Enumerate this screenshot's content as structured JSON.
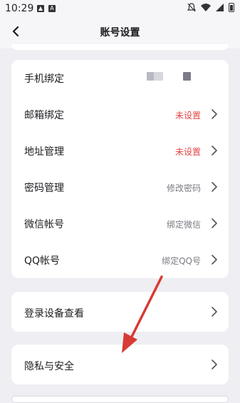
{
  "status_bar": {
    "time": "10:29"
  },
  "header": {
    "title": "账号设置"
  },
  "account_card": {
    "rows": [
      {
        "label": "手机绑定",
        "value": ""
      },
      {
        "label": "邮箱绑定",
        "value": "未设置"
      },
      {
        "label": "地址管理",
        "value": "未设置"
      },
      {
        "label": "密码管理",
        "value": "修改密码"
      },
      {
        "label": "微信帐号",
        "value": "绑定微信"
      },
      {
        "label": "QQ帐号",
        "value": "绑定QQ号"
      }
    ]
  },
  "devices_card": {
    "label": "登录设备查看"
  },
  "privacy_card": {
    "label": "隐私与安全"
  },
  "colors": {
    "accent_red": "#e64545",
    "muted": "#7b7b83",
    "background": "#eeeef3"
  },
  "icons": {
    "back": "chevron-left-icon",
    "row_arrow": "chevron-right-icon"
  }
}
